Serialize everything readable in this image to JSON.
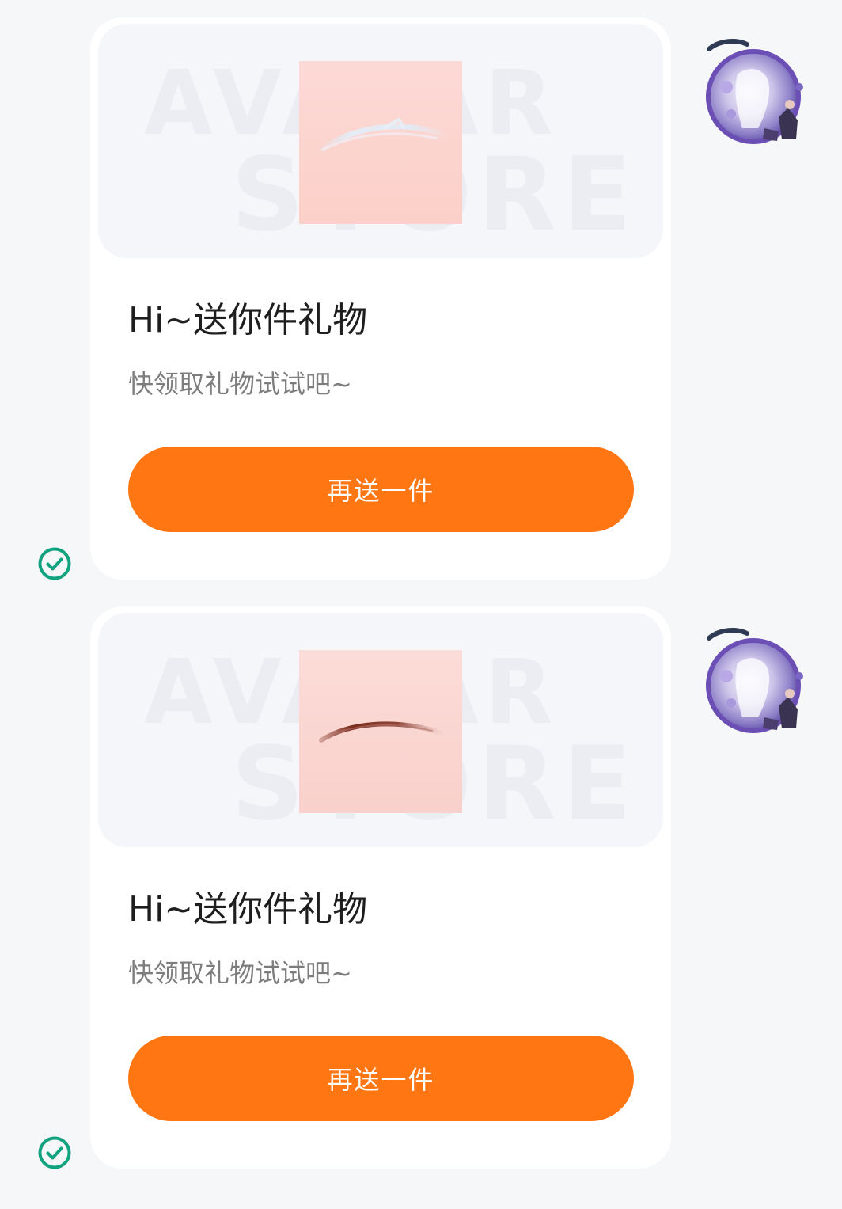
{
  "messages": [
    {
      "title": "Hi~送你件礼物",
      "subtitle": "快领取礼物试试吧~",
      "button_label": "再送一件",
      "watermark_line1": "AVATAR",
      "watermark_line2": "STORE",
      "item_icon": "eyebrow-light-icon",
      "status_icon": "check-circle-icon"
    },
    {
      "title": "Hi~送你件礼物",
      "subtitle": "快领取礼物试试吧~",
      "button_label": "再送一件",
      "watermark_line1": "AVATAR",
      "watermark_line2": "STORE",
      "item_icon": "eyebrow-brown-icon",
      "status_icon": "check-circle-icon"
    }
  ],
  "colors": {
    "page_background": "#f6f7f9",
    "card_background": "#ffffff",
    "button_accent": "#ff7613",
    "status_green": "#11a37f"
  }
}
